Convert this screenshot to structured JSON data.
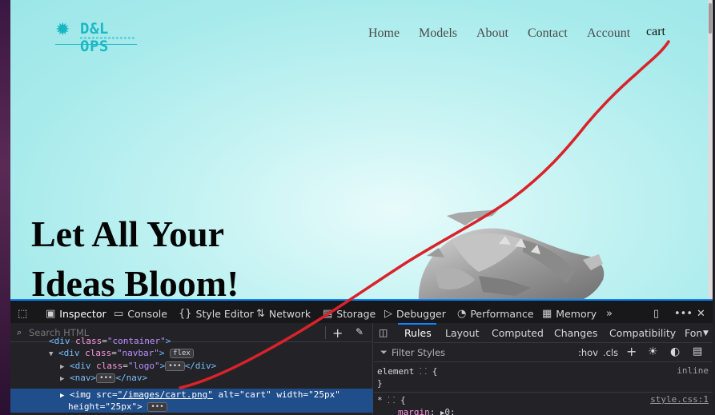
{
  "site": {
    "logo_text": "D&L OPS",
    "nav": [
      "Home",
      "Models",
      "About",
      "Contact",
      "Account"
    ],
    "cart": "cart",
    "hero_line1": "Let All Your",
    "hero_line2": "Ideas Bloom!"
  },
  "devtools": {
    "tabs": [
      "Inspector",
      "Console",
      "Style Editor",
      "Network",
      "Storage",
      "Debugger",
      "Performance",
      "Memory"
    ],
    "search_placeholder": "Search HTML",
    "tree": {
      "l0_tag": "<div",
      "l0_attr": "class",
      "l0_val": "\"container\"",
      "l1_open": "<div",
      "l1_attr": "class",
      "l1_val": "\"navbar\"",
      "l1_close": ">",
      "l1_badge": "flex",
      "l2_open": "<div",
      "l2_attr": "class",
      "l2_val": "\"logo\"",
      "l2_close": ">",
      "l2_end": "</div>",
      "l3_open": "<nav>",
      "l3_end": "</nav>",
      "l4_open": "<img",
      "l4_src_attr": "src",
      "l4_src_val": "\"/images/cart.png\"",
      "l4_alt_attr": "alt",
      "l4_alt_val": "\"cart\"",
      "l4_w_attr": "width",
      "l4_w_val": "\"25px\"",
      "l4_h_attr": "height",
      "l4_h_val": "\"25px\"",
      "l4_close": ">"
    },
    "sub_tabs": [
      "Rules",
      "Layout",
      "Computed",
      "Changes",
      "Compatibility",
      "Fon"
    ],
    "filter_placeholder": "Filter Styles",
    "hov": ":hov",
    "cls": ".cls",
    "rules": {
      "element_selector": "element",
      "element_brace": "{",
      "element_source": "inline",
      "element_close": "}",
      "star_selector": "*",
      "star_brace": "{",
      "star_source": "style.css:1",
      "prop": "margin",
      "prop_val": "0;"
    }
  },
  "colors": {
    "annotation": "#d9232a",
    "accent": "#0a84ff",
    "logo": "#1bb9c6"
  }
}
